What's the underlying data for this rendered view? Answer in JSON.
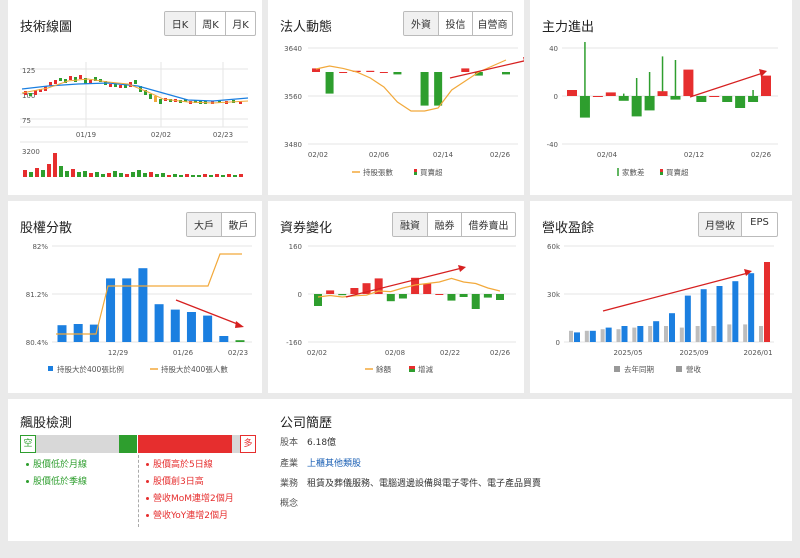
{
  "tech": {
    "title": "技術線圖",
    "tabs": [
      "日K",
      "周K",
      "月K"
    ],
    "y_ticks": [
      "125",
      "100",
      "75"
    ],
    "x_ticks": [
      "01/19",
      "02/02",
      "02/23"
    ],
    "vol_tick": "3200"
  },
  "inst": {
    "title": "法人動態",
    "tabs": [
      "外資",
      "投信",
      "自營商"
    ],
    "y_ticks": [
      "3640",
      "3560",
      "3480"
    ],
    "x_ticks": [
      "02/02",
      "02/06",
      "02/14",
      "02/26"
    ],
    "legend": [
      "持股張數",
      "買賣超"
    ]
  },
  "major": {
    "title": "主力進出",
    "y_ticks": [
      "40",
      "0",
      "-40"
    ],
    "x_ticks": [
      "02/04",
      "02/12",
      "02/26"
    ],
    "legend": [
      "家數差",
      "買賣超"
    ]
  },
  "dist": {
    "title": "股權分散",
    "tabs": [
      "大戶",
      "散戶"
    ],
    "y_ticks": [
      "82%",
      "81.2%",
      "80.4%"
    ],
    "x_ticks": [
      "12/29",
      "01/26",
      "02/23"
    ],
    "legend": [
      "持股大於400張比例",
      "持股大於400張人數"
    ]
  },
  "margin": {
    "title": "資券變化",
    "tabs": [
      "融資",
      "融券",
      "借券賣出"
    ],
    "y_ticks": [
      "160",
      "0",
      "-160"
    ],
    "x_ticks": [
      "02/02",
      "02/08",
      "02/22",
      "02/26"
    ],
    "legend": [
      "餘額",
      "增減"
    ]
  },
  "rev": {
    "title": "營收盈餘",
    "tabs": [
      "月營收",
      "EPS"
    ],
    "y_ticks": [
      "60k",
      "30k",
      "0"
    ],
    "x_ticks": [
      "2025/05",
      "2025/09",
      "2026/01"
    ],
    "legend": [
      "去年同期",
      "營收"
    ]
  },
  "check": {
    "title": "飆股檢測",
    "bear_label": "空",
    "bull_label": "多",
    "bear_items": [
      "股價低於月線",
      "股價低於季線"
    ],
    "bull_items": [
      "股價高於5日線",
      "股價創3日高",
      "營收MoM連增2個月",
      "營收YoY連增2個月"
    ],
    "bear_level": 0.08,
    "bull_level": 0.4
  },
  "profile": {
    "title": "公司簡歷",
    "capital_label": "股本",
    "capital_value": "6.18億",
    "industry_label": "產業",
    "industry_value": "上櫃其他類股",
    "business_label": "業務",
    "business_value": "租賃及葬儀服務、電腦週邊設備與電子零件、電子產品買賣",
    "concept_label": "概念"
  },
  "colors": {
    "red": "#e62e2e",
    "green": "#2e9e2e",
    "blue": "#1b7fe0",
    "orange": "#f2a93b",
    "gray": "#999999"
  },
  "chart_data": [
    {
      "type": "bar",
      "title": "",
      "categories": [
        "02/02",
        "02/03",
        "02/04",
        "02/05",
        "02/06",
        "02/09",
        "02/10",
        "02/11",
        "02/12",
        "02/13",
        "02/14",
        "02/23",
        "02/24",
        "02/25",
        "02/26"
      ],
      "series": [
        {
          "name": "買賣超",
          "values": [
            3,
            -18,
            0,
            1,
            1,
            0,
            -2,
            null,
            -28,
            -28,
            null,
            3,
            -3,
            null,
            -2
          ]
        },
        {
          "name": "持股張數",
          "values": [
            3605,
            3610,
            3606,
            3600,
            3590,
            3575,
            3550,
            3535,
            3535,
            3540,
            3570,
            3585,
            3600,
            3610,
            3620
          ]
        }
      ],
      "ylim": [
        3480,
        3640
      ]
    },
    {
      "type": "bar",
      "title": "",
      "categories": [
        "1",
        "2",
        "3",
        "4",
        "5",
        "6",
        "7",
        "8",
        "9",
        "10",
        "11",
        "12",
        "13",
        "14",
        "15",
        "16"
      ],
      "series": [
        {
          "name": "買賣超",
          "values": [
            5,
            -18,
            0,
            3,
            -4,
            -17,
            -12,
            4,
            -3,
            22,
            -5,
            0,
            -5,
            -10,
            -5,
            17
          ]
        },
        {
          "name": "家數差",
          "values": [
            0,
            45,
            0,
            0,
            2,
            15,
            20,
            33,
            30,
            0,
            0,
            0,
            0,
            0,
            5,
            0
          ]
        }
      ],
      "ylim": [
        -40,
        40
      ]
    },
    {
      "type": "bar",
      "title": "",
      "categories": [
        "12/08",
        "12/15",
        "12/22",
        "12/29",
        "01/05",
        "01/12",
        "01/19",
        "01/26",
        "02/02",
        "02/09",
        "02/16",
        "02/23"
      ],
      "series": [
        {
          "name": "持股大於400張比例",
          "values": [
            80.68,
            80.7,
            80.69,
            81.46,
            81.46,
            81.63,
            81.03,
            80.94,
            80.9,
            80.84,
            80.5,
            80.43
          ]
        },
        {
          "name": "持股大於400張人數",
          "values": [
            2,
            2,
            2,
            4,
            4,
            4,
            4,
            4,
            6,
            6,
            6,
            6
          ]
        }
      ],
      "ylim": [
        80.4,
        82.0
      ]
    },
    {
      "type": "bar",
      "title": "",
      "categories": [
        "02/02",
        "02/03",
        "02/04",
        "02/05",
        "02/06",
        "02/08",
        "02/09",
        "02/10",
        "02/11",
        "02/12",
        "02/13",
        "02/22",
        "02/23",
        "02/24",
        "02/25",
        "02/26"
      ],
      "series": [
        {
          "name": "增減",
          "values": [
            -40,
            12,
            -4,
            20,
            36,
            52,
            -24,
            -15,
            54,
            35,
            0,
            -22,
            -10,
            -50,
            -12,
            -20
          ]
        },
        {
          "name": "餘額",
          "values": [
            -10,
            -5,
            -10,
            -6,
            -4,
            10,
            8,
            20,
            30,
            35,
            40,
            52,
            40,
            35,
            20,
            10
          ]
        }
      ],
      "ylim": [
        -160,
        160
      ]
    },
    {
      "type": "bar",
      "title": "",
      "categories": [
        "2025/01",
        "2025/02",
        "2025/03",
        "2025/04",
        "2025/05",
        "2025/06",
        "2025/07",
        "2025/08",
        "2025/09",
        "2025/10",
        "2025/11",
        "2025/12",
        "2026/01"
      ],
      "series": [
        {
          "name": "去年同期",
          "values": [
            7,
            7,
            8,
            8,
            9,
            10,
            10,
            9,
            10,
            10,
            11,
            11,
            10
          ]
        },
        {
          "name": "營收",
          "values": [
            6,
            7,
            9,
            10,
            10,
            13,
            18,
            29,
            33,
            35,
            38,
            43,
            50
          ]
        }
      ],
      "ylim": [
        0,
        60
      ]
    }
  ]
}
